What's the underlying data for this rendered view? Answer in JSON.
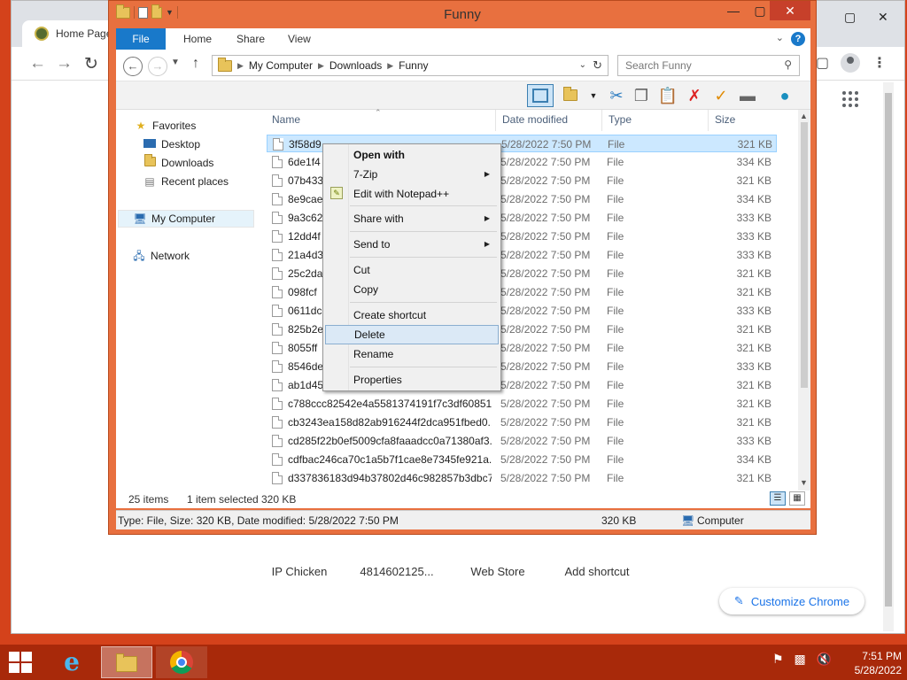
{
  "chrome": {
    "tab_title": "Home Page",
    "customize_label": "Customize Chrome",
    "shortcuts": [
      "IP Chicken",
      "4814602125...",
      "Web Store",
      "Add shortcut"
    ]
  },
  "explorer": {
    "title": "Funny",
    "ribbon_tabs": [
      "File",
      "Home",
      "Share",
      "View"
    ],
    "breadcrumb": [
      "My Computer",
      "Downloads",
      "Funny"
    ],
    "search_placeholder": "Search Funny",
    "nav": {
      "favorites": "Favorites",
      "desktop": "Desktop",
      "downloads": "Downloads",
      "recent": "Recent places",
      "computer": "My Computer",
      "network": "Network"
    },
    "columns": [
      "Name",
      "Date modified",
      "Type",
      "Size"
    ],
    "files": [
      {
        "name": "3f58d9",
        "date": "5/28/2022 7:50 PM",
        "type": "File",
        "size": "321 KB"
      },
      {
        "name": "6de1f4",
        "date": "5/28/2022 7:50 PM",
        "type": "File",
        "size": "334 KB"
      },
      {
        "name": "07b433",
        "date": "5/28/2022 7:50 PM",
        "type": "File",
        "size": "321 KB"
      },
      {
        "name": "8e9cae",
        "date": "5/28/2022 7:50 PM",
        "type": "File",
        "size": "334 KB"
      },
      {
        "name": "9a3c62",
        "date": "5/28/2022 7:50 PM",
        "type": "File",
        "size": "333 KB"
      },
      {
        "name": "12dd4f",
        "date": "5/28/2022 7:50 PM",
        "type": "File",
        "size": "333 KB"
      },
      {
        "name": "21a4d3",
        "date": "5/28/2022 7:50 PM",
        "type": "File",
        "size": "333 KB"
      },
      {
        "name": "25c2da",
        "date": "5/28/2022 7:50 PM",
        "type": "File",
        "size": "321 KB"
      },
      {
        "name": "098fcf",
        "date": "5/28/2022 7:50 PM",
        "type": "File",
        "size": "321 KB"
      },
      {
        "name": "0611dc",
        "date": "5/28/2022 7:50 PM",
        "type": "File",
        "size": "333 KB"
      },
      {
        "name": "825b2e",
        "date": "5/28/2022 7:50 PM",
        "type": "File",
        "size": "321 KB"
      },
      {
        "name": "8055ff",
        "date": "5/28/2022 7:50 PM",
        "type": "File",
        "size": "321 KB"
      },
      {
        "name": "8546de",
        "date": "5/28/2022 7:50 PM",
        "type": "File",
        "size": "333 KB"
      },
      {
        "name": "ab1d45",
        "date": "5/28/2022 7:50 PM",
        "type": "File",
        "size": "321 KB"
      },
      {
        "name": "c788ccc82542e4a5581374191f7c3df60851...",
        "date": "5/28/2022 7:50 PM",
        "type": "File",
        "size": "321 KB"
      },
      {
        "name": "cb3243ea158d82ab916244f2dca951fbed0...",
        "date": "5/28/2022 7:50 PM",
        "type": "File",
        "size": "321 KB"
      },
      {
        "name": "cd285f22b0ef5009cfa8faaadcc0a71380af3...",
        "date": "5/28/2022 7:50 PM",
        "type": "File",
        "size": "333 KB"
      },
      {
        "name": "cdfbac246ca70c1a5b7f1cae8e7345fe921a...",
        "date": "5/28/2022 7:50 PM",
        "type": "File",
        "size": "334 KB"
      },
      {
        "name": "d337836183d94b37802d46c982857b3dbc7...",
        "date": "5/28/2022 7:50 PM",
        "type": "File",
        "size": "321 KB"
      }
    ],
    "status": {
      "items": "25 items",
      "selected": "1 item selected",
      "selected_size": "320 KB"
    },
    "details": {
      "info": "Type: File, Size: 320 KB, Date modified: 5/28/2022 7:50 PM",
      "size": "320 KB",
      "location": "Computer"
    }
  },
  "context_menu": {
    "open_with": "Open with",
    "seven_zip": "7-Zip",
    "notepad": "Edit with Notepad++",
    "share_with": "Share with",
    "send_to": "Send to",
    "cut": "Cut",
    "copy": "Copy",
    "create_shortcut": "Create shortcut",
    "delete": "Delete",
    "rename": "Rename",
    "properties": "Properties"
  },
  "taskbar": {
    "time": "7:51 PM",
    "date": "5/28/2022"
  },
  "colors": {
    "desktop": "#d4421b",
    "window_frame": "#e8703f",
    "taskbar": "#a8290a",
    "accent_blue": "#1979ca",
    "selection": "#cce8ff"
  }
}
